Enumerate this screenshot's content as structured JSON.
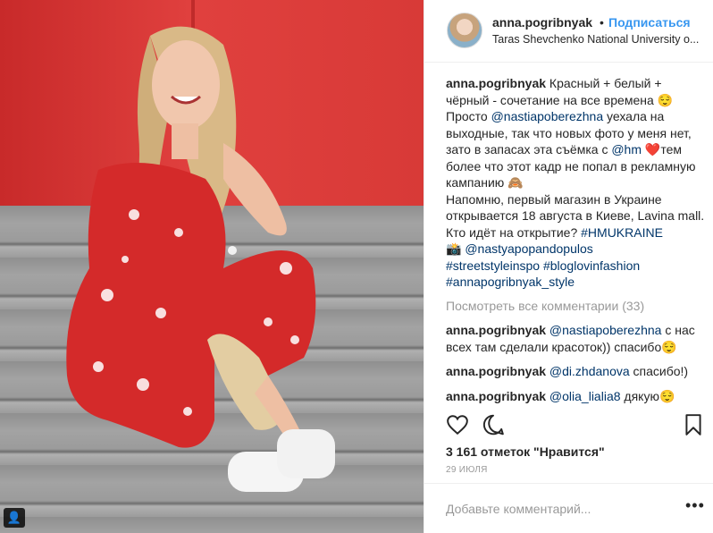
{
  "header": {
    "username": "anna.pogribnyak",
    "separator": "•",
    "follow_label": "Подписаться",
    "location": "Taras Shevchenko National University o..."
  },
  "caption": {
    "username": "anna.pogribnyak",
    "text1": "Красный + белый + чёрный - сочетание на все времена 😌",
    "text2": "Просто",
    "mention1": "@nastiapoberezhna",
    "text3": "уехала на выходные, так что новых фото у меня нет, зато в запасах эта съёмка с",
    "mention2": "@hm",
    "text4": "❤️тем более что этот кадр не попал в рекламную кампанию 🙈",
    "text5": "Напомню, первый магазин в Украине открывается 18 августа в Киеве, Lavina mall. Кто идёт на открытие?",
    "tag1": "#HMUKRAINE",
    "camera": "📸",
    "mention3": "@nastyapopandopulos",
    "tag2": "#streetstyleinspo",
    "tag3": "#bloglovinfashion",
    "tag4": "#annapogribnyak_style"
  },
  "view_all_comments": "Посмотреть все комментарии (33)",
  "comments": [
    {
      "username": "anna.pogribnyak",
      "mention": "@nastiapoberezhna",
      "text": "с нас всех там сделали красоток)) спасибо😌"
    },
    {
      "username": "anna.pogribnyak",
      "mention": "@di.zhdanova",
      "text": "спасибо!)"
    },
    {
      "username": "anna.pogribnyak",
      "mention": "@olia_lialia8",
      "text": "дякую😌"
    }
  ],
  "actions": {
    "like_icon": "heart-icon",
    "comment_icon": "comment-bubble-icon",
    "save_icon": "bookmark-icon"
  },
  "likes_text": "3 161 отметок \"Нравится\"",
  "date": "29 ИЮЛЯ",
  "add_comment_placeholder": "Добавьте комментарий...",
  "more_options": "•••",
  "colors": {
    "link": "#003569",
    "follow": "#3897f0",
    "muted": "#999999",
    "wall_red": "#d83a37",
    "dress_red": "#d42a2a"
  }
}
